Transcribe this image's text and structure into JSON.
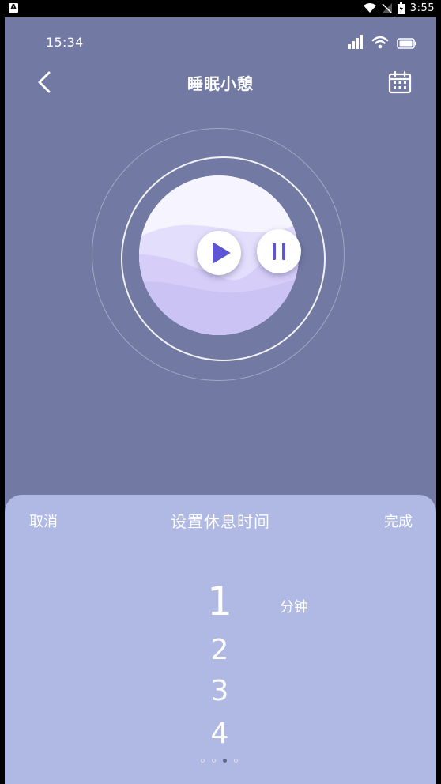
{
  "system_status": {
    "time": "3:55"
  },
  "app_status": {
    "time": "15:34"
  },
  "header": {
    "title": "睡眠小憩"
  },
  "icons": {
    "back": "chevron-left-icon",
    "calendar": "calendar-icon",
    "play": "play-icon",
    "pause": "pause-icon"
  },
  "sheet": {
    "cancel_label": "取消",
    "title": "设置休息时间",
    "done_label": "完成",
    "unit": "分钟",
    "options": [
      "1",
      "2",
      "3",
      "4"
    ],
    "selected": "1",
    "page_dots": {
      "count": 4,
      "active": 3
    }
  },
  "colors": {
    "background": "#7279a3",
    "sheet": "#b0b8e4",
    "accent": "#5e55d6"
  }
}
